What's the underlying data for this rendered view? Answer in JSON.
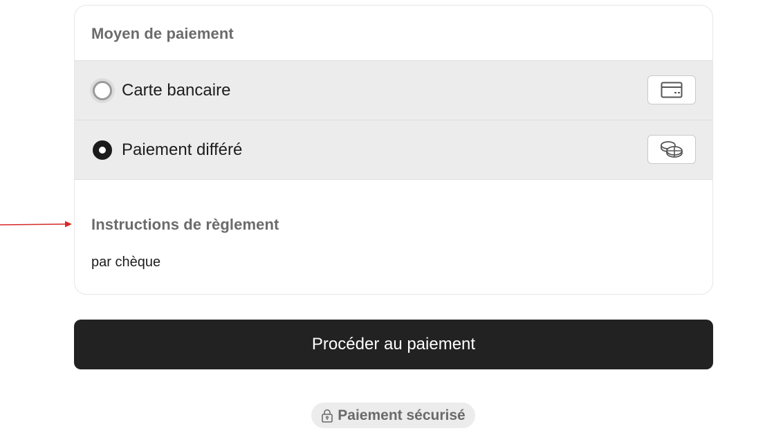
{
  "payment_method": {
    "title": "Moyen de paiement",
    "options": [
      {
        "label": "Carte bancaire",
        "selected": false,
        "icon": "credit-card-icon"
      },
      {
        "label": "Paiement différé",
        "selected": true,
        "icon": "coins-icon"
      }
    ]
  },
  "instructions": {
    "title": "Instructions de règlement",
    "text": "par chèque"
  },
  "actions": {
    "submit_label": "Procéder au paiement"
  },
  "security": {
    "badge_label": "Paiement sécurisé",
    "icon": "lock-icon"
  },
  "colors": {
    "annotation_arrow": "#d62828",
    "button_bg": "#222222",
    "option_bg": "#ececec"
  }
}
